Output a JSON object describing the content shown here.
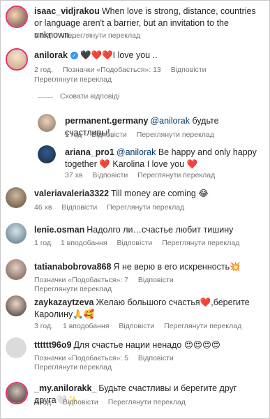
{
  "comments": [
    {
      "user": "isaac_vidjrakou",
      "text": "When love is strong, distance, countries or language aren't a barrier, but an invitation to the unknown...",
      "time": "4 год.",
      "likes": "",
      "reply": "",
      "translate": "Переглянути переклад"
    },
    {
      "user": "anilorak",
      "text": "🖤❤️❤️I love you ..",
      "time": "2 год.",
      "likes": "Позначки «Подобається»: 13",
      "reply": "Відповісти",
      "translate": "Переглянути переклад"
    },
    {
      "user": "permanent.germany",
      "mention": "@anilorak",
      "text": "будьте счастливы!",
      "time": "1 год",
      "reply": "Відповісти",
      "translate": "Переглянути переклад"
    },
    {
      "user": "ariana_pro1",
      "mention": "@anilorak",
      "text": "Be happy and only happy together ❤️ Karolina I love you ❤️",
      "time": "37 хв",
      "reply": "Відповісти",
      "translate": "Переглянути переклад"
    },
    {
      "user": "valeriavaleria3322",
      "text": "Till money are coming 😂",
      "time": "46 хв",
      "reply": "Відповісти",
      "translate": "Переглянути переклад"
    },
    {
      "user": "lenie.osman",
      "text": "Надолго ли…счастье любит тишину",
      "time": "1 год",
      "likes": "1 вподобання",
      "reply": "Відповісти",
      "translate": "Переглянути переклад"
    },
    {
      "user": "tatianabobrova868",
      "text": "Я не верю в его искренность💥",
      "time": "",
      "likes": "Позначки «Подобається»: 7",
      "reply": "Відповісти",
      "translate": "Переглянути переклад"
    },
    {
      "user": "zaykazaytzeva",
      "text": "Желаю большого счастья❤️,берегите Каролину🙏🥰",
      "time": "3 год.",
      "likes": "1 вподобання",
      "reply": "Відповісти",
      "translate": "Переглянути переклад"
    },
    {
      "user": "tttttt96o9",
      "text": "Для счастье нации ненадо 😍😍😍😍",
      "time": "",
      "likes": "Позначки «Подобається»: 5",
      "reply": "Відповісти",
      "translate": "Переглянути переклад"
    },
    {
      "user": "_my.anilorakk_",
      "text": "Будьте счастливы и берегите друг друга🤍✨",
      "time": "3 год.",
      "reply": "Відповісти",
      "translate": "Переглянути переклад"
    }
  ],
  "hide_replies": "Сховати відповіді"
}
